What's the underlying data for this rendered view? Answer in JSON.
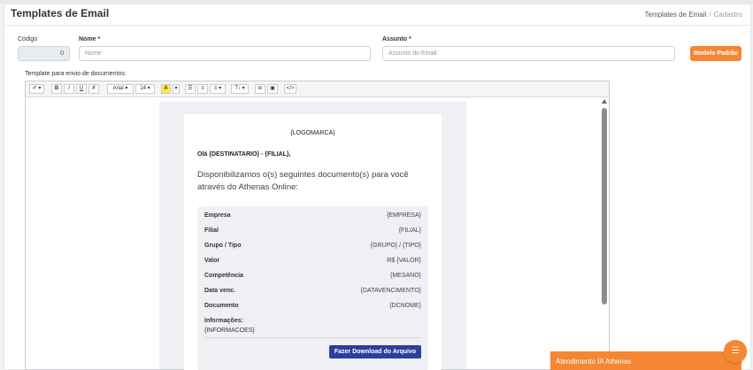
{
  "page": {
    "title": "Templates de Email",
    "breadcrumb": [
      "Templates de Email",
      "Cadastro"
    ]
  },
  "form": {
    "codigo_label": "Código",
    "codigo_value": "0",
    "nome_label": "Nome *",
    "nome_placeholder": "Nome",
    "assunto_label": "Assunto *",
    "assunto_placeholder": "Assunto do Email",
    "modelo_button": "Modelo Padrão",
    "template_label": "Template para envio de documentos:"
  },
  "toolbar": {
    "style": "✐ ▾",
    "bold": "B",
    "italic": "I",
    "underline": "U",
    "eraser": "✗",
    "font": "Arial ▾",
    "size": "14 ▾",
    "color_a": "A",
    "color_caret": "▾",
    "ul": "☰",
    "ol": "≡",
    "align": "≡ ▾",
    "height": "T↕ ▾",
    "link": "⊖",
    "image": "▣",
    "code": "</>"
  },
  "email": {
    "logo": "{LOGOMARCA}",
    "greeting": "Olá {DESTINATARIO} - {FILIAL},",
    "message": "Disponibilizamos o(s) seguintes documento(s) para você através do Athenas Online:",
    "rows": [
      {
        "label": "Empresa",
        "value": "{EMPRESA}"
      },
      {
        "label": "Filial",
        "value": "{FILIAL}"
      },
      {
        "label": "Grupo / Tipo",
        "value": "{GRUPO} / {TIPO}"
      },
      {
        "label": "Valor",
        "value": "R$ {VALOR}"
      },
      {
        "label": "Competência",
        "value": "{MESANO}"
      },
      {
        "label": "Data venc.",
        "value": "{DATAVENCIMENTO}"
      },
      {
        "label": "Documento",
        "value": "{DCNOME}"
      }
    ],
    "info_label": "Informações:",
    "info_value": "{INFORMACOES}",
    "download_button": "Fazer Download do Arquivo"
  },
  "chat": {
    "title": "Atendimento IA Athenas",
    "icon": "chat-icon"
  },
  "colors": {
    "accent": "#f58632",
    "download": "#2c3e9e"
  }
}
